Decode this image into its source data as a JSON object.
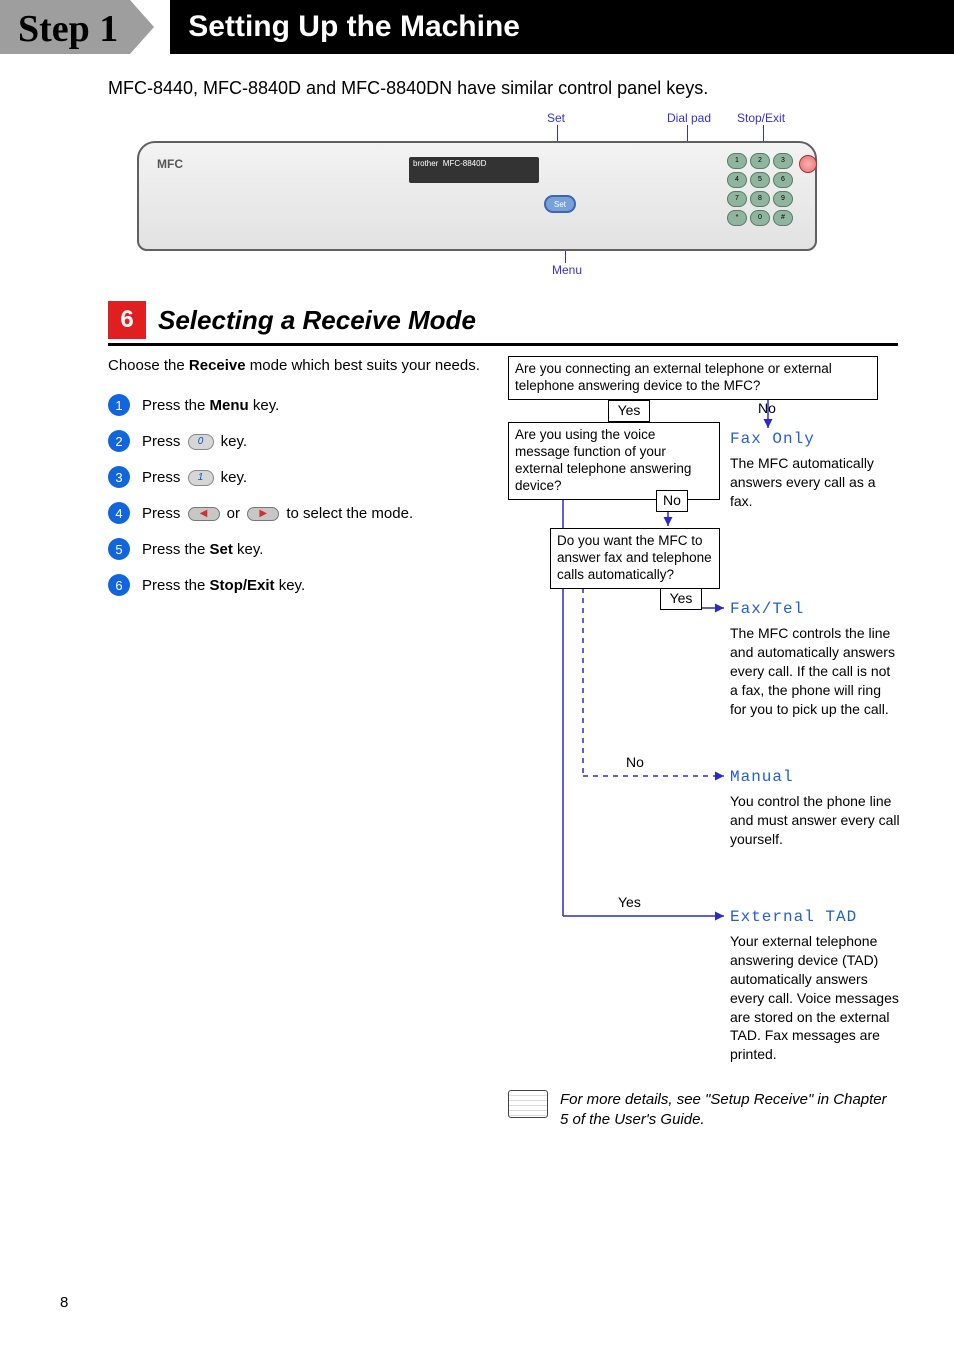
{
  "step_label": "Step 1",
  "header_title": "Setting Up the Machine",
  "intro": "MFC-8440, MFC-8840D and MFC-8840DN have similar control panel keys.",
  "panel_labels": {
    "set": "Set",
    "dialpad": "Dial pad",
    "stopexit": "Stop/Exit",
    "menu": "Menu"
  },
  "dialpad_keys": [
    "1",
    "2",
    "3",
    "4",
    "5",
    "6",
    "7",
    "8",
    "9",
    "*",
    "0",
    "#"
  ],
  "section_number": "6",
  "section_title": "Selecting a Receive Mode",
  "choose_prefix": "Choose the ",
  "choose_bold": "Receive",
  "choose_suffix": " mode which best suits your needs.",
  "steps": [
    {
      "n": "1",
      "pre": "Press the ",
      "bold": "Menu",
      "post": " key."
    },
    {
      "n": "2",
      "pre": "Press ",
      "pill": "0",
      "post": " key."
    },
    {
      "n": "3",
      "pre": "Press ",
      "pill": "1",
      "post": " key."
    },
    {
      "n": "4",
      "pre": "Press ",
      "nav": true,
      "mid": " or ",
      "post": " to select the mode."
    },
    {
      "n": "5",
      "pre": "Press the ",
      "bold": "Set",
      "post": " key."
    },
    {
      "n": "6",
      "pre": "Press the ",
      "bold": "Stop/Exit",
      "post": " key."
    }
  ],
  "flow": {
    "q1": "Are you connecting an external telephone or external telephone answering device to the MFC?",
    "q2": "Are you using the voice message function of your external telephone answering device?",
    "q3": "Do you want the MFC to answer fax and telephone calls automatically?",
    "yes": "Yes",
    "no": "No"
  },
  "modes": {
    "fax_only": {
      "name": "Fax Only",
      "desc": "The MFC automatically answers every call as a fax."
    },
    "fax_tel": {
      "name": "Fax/Tel",
      "desc": "The MFC controls the line and automatically answers every call. If the call is not a fax, the phone will ring for you to pick up the call."
    },
    "manual": {
      "name": "Manual",
      "desc": "You control the phone line and must answer every call yourself."
    },
    "ext_tad": {
      "name": "External TAD",
      "desc": "Your external telephone answering device (TAD) automatically answers every call. Voice messages are stored on the external TAD. Fax messages are printed."
    }
  },
  "more_info": "For more details, see \"Setup Receive\" in Chapter 5 of the User's Guide.",
  "page_number": "8"
}
